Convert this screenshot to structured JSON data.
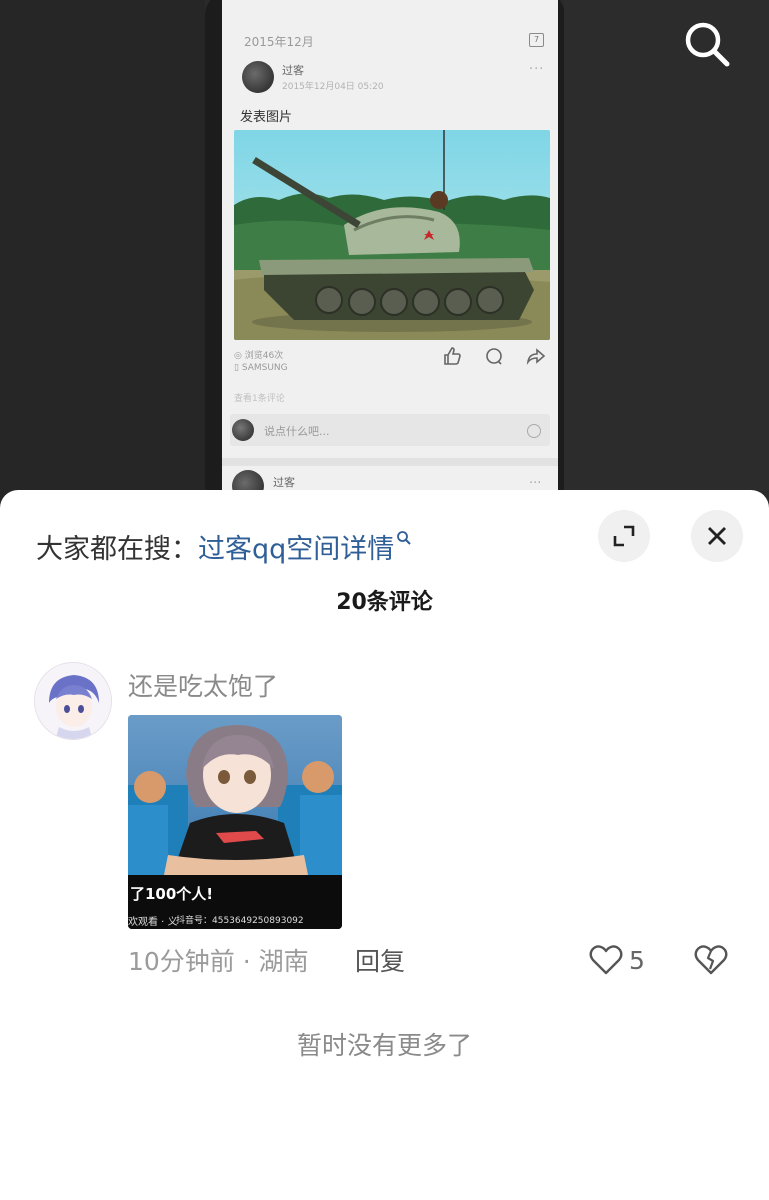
{
  "background_post": {
    "date_header": "2015年12月",
    "calendar_day": "7",
    "author": "过客",
    "post_time": "2015年12月04日 05:20",
    "title": "发表图片",
    "views": "◎ 浏览46次",
    "device": "▯ SAMSUNG",
    "view_comments": "查看1条评论",
    "comment_placeholder": "说点什么吧...",
    "next_author": "过客"
  },
  "hot_search": {
    "prefix": "大家都在搜：",
    "term": "过客qq空间详情"
  },
  "comments_header": "20条评论",
  "comment": {
    "text": "还是吃太饱了",
    "image_caption": "了100个人!",
    "image_watermark_left": "欢观看 · 义",
    "image_watermark_right": "抖音号：4553649250893092",
    "meta": "10分钟前 · 湖南",
    "reply_label": "回复",
    "like_count": "5"
  },
  "footer_text": "暂时没有更多了",
  "colors": {
    "link_blue": "#2f5f96",
    "sheet_bg": "#ffffff",
    "muted_text": "#8a8a8a"
  },
  "icons": {
    "search": "search-icon",
    "expand": "expand-icon",
    "close": "close-icon",
    "like": "heart-icon",
    "dislike": "broken-heart-icon"
  }
}
